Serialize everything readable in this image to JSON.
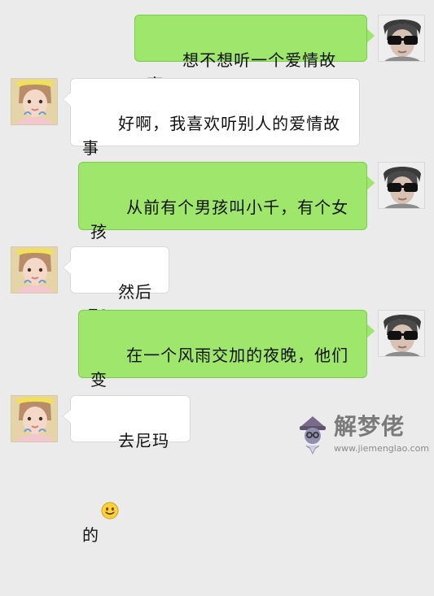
{
  "messages": [
    {
      "side": "right",
      "text": "想不想听一个爱情故事！",
      "emoji": false
    },
    {
      "side": "left",
      "text": "好啊，我喜欢听别人的爱情故事",
      "emoji": true
    },
    {
      "side": "right",
      "text": "从前有个男孩叫小千，有个女孩\n叫小北",
      "emoji": false
    },
    {
      "side": "left",
      "text": "然后呢？",
      "emoji": false
    },
    {
      "side": "right",
      "text": "在一个风雨交加的夜晚，他们变\n成了小小乖",
      "emoji": false
    },
    {
      "side": "left",
      "text": "去尼玛的",
      "emoji": true
    }
  ],
  "icons": {
    "emoji": "smile-emoji-icon",
    "avatar_right": "male-avatar-icon",
    "avatar_left": "female-avatar-icon",
    "watermark_logo": "wizard-hat-logo-icon"
  },
  "colors": {
    "background": "#ebebeb",
    "bubble_right": "#9ee66c",
    "bubble_left": "#ffffff",
    "watermark": "#7a7a7a"
  },
  "watermark": {
    "title": "解梦佬",
    "url": "www.jiemenglao.com"
  }
}
